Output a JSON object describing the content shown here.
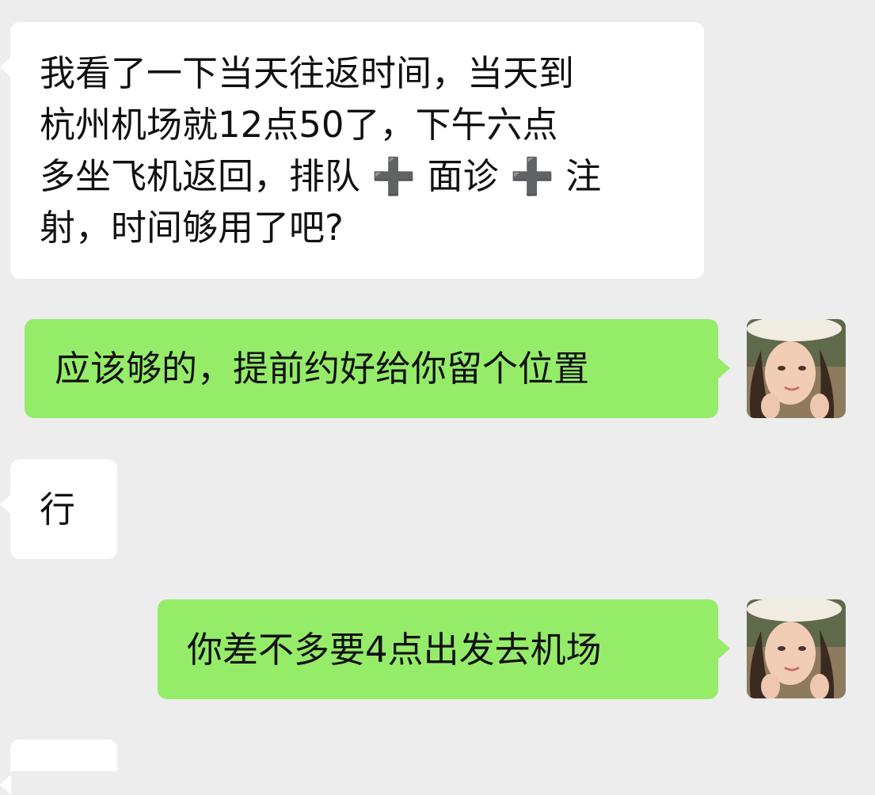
{
  "chat": {
    "messages": [
      {
        "side": "left",
        "text": "我看了一下当天往返时间，当天到\n杭州机场就12点50了，下午六点\n多坐飞机返回，排队 ➕ 面诊 ➕ 注\n射，时间够用了吧?"
      },
      {
        "side": "right",
        "text": "应该够的，提前约好给你留个位置"
      },
      {
        "side": "left",
        "text": "行"
      },
      {
        "side": "right",
        "text": "你差不多要4点出发去机场"
      },
      {
        "side": "left",
        "text": ""
      }
    ]
  },
  "colors": {
    "background": "#ededed",
    "incoming_bubble": "#ffffff",
    "outgoing_bubble": "#95ec69",
    "text": "#111111"
  }
}
